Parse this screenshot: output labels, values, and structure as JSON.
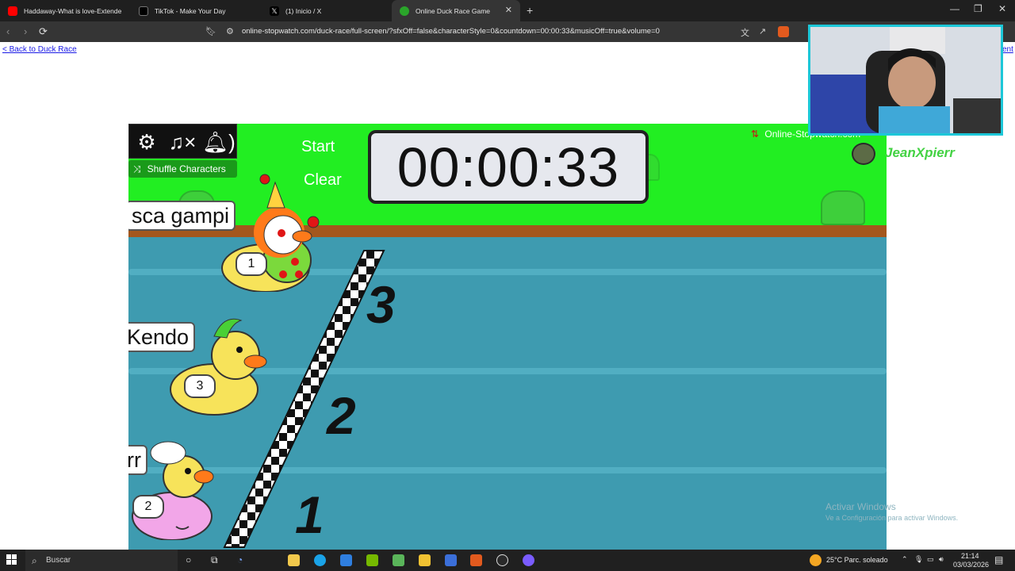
{
  "browser": {
    "tabs": [
      {
        "title": "Haddaway-What is love-Extende",
        "active": false,
        "favicon": "youtube-icon",
        "color": "#ff0000"
      },
      {
        "title": "TikTok - Make Your Day",
        "active": false,
        "favicon": "tiktok-icon",
        "color": "#000000"
      },
      {
        "title": "(1) Inicio / X",
        "active": false,
        "favicon": "x-icon",
        "color": "#000000"
      },
      {
        "title": "Online Duck Race Game",
        "active": true,
        "favicon": "stopwatch-icon",
        "color": "#2aa52a"
      }
    ],
    "url": "online-stopwatch.com/duck-race/full-screen/?sfxOff=false&characterStyle=0&countdown=00:00:33&musicOff=true&volume=0"
  },
  "page": {
    "back_link": "< Back to Duck Race",
    "edge_link": "ent"
  },
  "game": {
    "shuffle_label": "Shuffle Characters",
    "start_label": "Start",
    "clear_label": "Clear",
    "timer": "00:00:33",
    "brand": "Online-Stopwatch.com",
    "colors": {
      "grass": "#22ee22",
      "dirt": "#a4571d",
      "water": "#3e9bb0"
    },
    "racers": [
      {
        "name": "sca gampi",
        "number": "1",
        "body_color": "#f7e35a",
        "style": "clown"
      },
      {
        "name": "Kendo",
        "number": "3",
        "body_color": "#f7e35a",
        "style": "mohawk"
      },
      {
        "name": "rr",
        "number": "2",
        "body_color": "#f2a6e8",
        "style": "chef"
      }
    ],
    "lane_numbers": [
      "3",
      "2",
      "1"
    ]
  },
  "stream": {
    "streamer_name": "JeanXpierr",
    "watermark_line1": "Activar Windows",
    "watermark_line2": "Ve a Configuración para activar Windows."
  },
  "taskbar": {
    "search_placeholder": "Buscar",
    "weather": "25°C  Parc. soleado",
    "time": "21:14",
    "date": "03/03/2026"
  }
}
